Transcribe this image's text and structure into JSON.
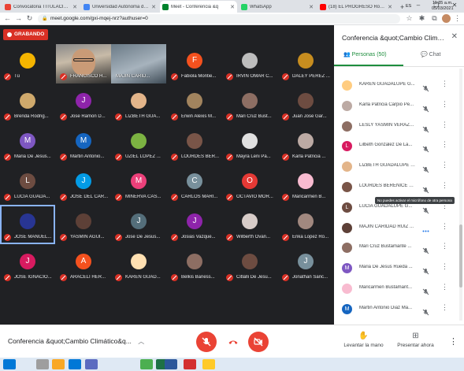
{
  "browser": {
    "tabs": [
      {
        "label": "Convocatoria TITULACIÓN I",
        "favicon_color": "#ea4335",
        "active": false
      },
      {
        "label": "Universidad Autónoma de G",
        "favicon_color": "#4285f4",
        "active": false
      },
      {
        "label": "Meet - Conferencia &q",
        "favicon_color": "#00832d",
        "active": true
      },
      {
        "label": "WhatsApp",
        "favicon_color": "#25d366",
        "active": false
      },
      {
        "label": "(18) EL PROGRESO Roberto",
        "favicon_color": "#ff0000",
        "active": false
      }
    ],
    "new_tab": "+",
    "url": "meet.google.com/gxi-mqej-nrz?authuser=0",
    "window_controls": [
      "–",
      "❐",
      "✕"
    ]
  },
  "recording_badge": "GRABANDO",
  "participants_grid": [
    {
      "name": "Tú",
      "initial": "",
      "color": "#f4b400",
      "muted": true,
      "video": false,
      "photo": true
    },
    {
      "name": "FRANCISCO H...",
      "initial": "",
      "color": "#555555",
      "muted": true,
      "video": true,
      "variant": "v1"
    },
    {
      "name": "MAJIN CARID...",
      "initial": "",
      "color": "#555555",
      "muted": false,
      "video": true,
      "variant": "v2",
      "active": true
    },
    {
      "name": "Fabiola Montie...",
      "initial": "F",
      "color": "#f4511e",
      "muted": true,
      "video": false
    },
    {
      "name": "IRVIN OMAR C...",
      "initial": "",
      "color": "#bdbdbd",
      "muted": true,
      "video": false,
      "photo": true
    },
    {
      "name": "DALEY PEREZ ...",
      "initial": "",
      "color": "#c78d1f",
      "muted": true,
      "video": false,
      "photo": true
    },
    {
      "name": "Brenda Rodrig...",
      "initial": "",
      "color": "#cfa96c",
      "muted": true,
      "video": false,
      "photo": true
    },
    {
      "name": "Jose Ramon D...",
      "initial": "J",
      "color": "#8e24aa",
      "muted": true,
      "video": false
    },
    {
      "name": "LIZBETH GUA...",
      "initial": "",
      "color": "#e3b58a",
      "muted": true,
      "video": false,
      "photo": true
    },
    {
      "name": "Erwin Alexis M...",
      "initial": "",
      "color": "#a2845e",
      "muted": true,
      "video": false,
      "photo": true
    },
    {
      "name": "Mari Cruz Bust...",
      "initial": "",
      "color": "#8d6e63",
      "muted": true,
      "video": false,
      "photo": true
    },
    {
      "name": "Juan Jose Gar...",
      "initial": "",
      "color": "#6d4c41",
      "muted": true,
      "video": false,
      "photo": true
    },
    {
      "name": "Maria De Jesus...",
      "initial": "M",
      "color": "#7e57c2",
      "muted": true,
      "video": false
    },
    {
      "name": "Martin Antonio...",
      "initial": "M",
      "color": "#1565c0",
      "muted": true,
      "video": false
    },
    {
      "name": "UZIEL LOPEZ ...",
      "initial": "",
      "color": "#7cb342",
      "muted": true,
      "video": false,
      "photo": true
    },
    {
      "name": "LOURDES BER...",
      "initial": "",
      "color": "#795548",
      "muted": true,
      "video": false,
      "photo": true
    },
    {
      "name": "Mayra Leni Pa...",
      "initial": "",
      "color": "#e0e0e0",
      "muted": true,
      "video": false,
      "photo": true
    },
    {
      "name": "Karla Patricia ...",
      "initial": "",
      "color": "#bcaaa4",
      "muted": true,
      "video": false,
      "photo": true
    },
    {
      "name": "LUCIA GUADA...",
      "initial": "L",
      "color": "#6d4c41",
      "muted": true,
      "video": false
    },
    {
      "name": "JOSE DEL CAR...",
      "initial": "J",
      "color": "#039be5",
      "muted": true,
      "video": false
    },
    {
      "name": "MINERVA CAS...",
      "initial": "M",
      "color": "#ec407a",
      "muted": true,
      "video": false
    },
    {
      "name": "CARLOS MARI...",
      "initial": "C",
      "color": "#78909c",
      "muted": true,
      "video": false
    },
    {
      "name": "OCTAVIO MOR...",
      "initial": "O",
      "color": "#e53935",
      "muted": true,
      "video": false
    },
    {
      "name": "Maricarmen B...",
      "initial": "",
      "color": "#f8bbd0",
      "muted": true,
      "video": false,
      "photo": true
    },
    {
      "name": "JOSE MANUEL...",
      "initial": "",
      "color": "#283593",
      "muted": true,
      "video": false,
      "photo": true,
      "active": true
    },
    {
      "name": "YASMIN AGUI...",
      "initial": "",
      "color": "#5d4037",
      "muted": true,
      "video": false,
      "photo": true
    },
    {
      "name": "Jose De Jesus...",
      "initial": "J",
      "color": "#546e7a",
      "muted": true,
      "video": false
    },
    {
      "name": "Josias Vazque...",
      "initial": "J",
      "color": "#8e24aa",
      "muted": true,
      "video": false
    },
    {
      "name": "Wilberth Ovan...",
      "initial": "",
      "color": "#d7ccc8",
      "muted": true,
      "video": false,
      "photo": true
    },
    {
      "name": "Erika Lopez Ro...",
      "initial": "",
      "color": "#a1887f",
      "muted": true,
      "video": false,
      "photo": true
    },
    {
      "name": "JOSE IGNACIO...",
      "initial": "J",
      "color": "#d81b60",
      "muted": true,
      "video": false
    },
    {
      "name": "ARACELI HER...",
      "initial": "A",
      "color": "#f4511e",
      "muted": true,
      "video": false
    },
    {
      "name": "KAREN GUAD...",
      "initial": "",
      "color": "#ffe0b2",
      "muted": true,
      "video": false,
      "photo": true
    },
    {
      "name": "Belkis Baness...",
      "initial": "",
      "color": "#8d6e63",
      "muted": true,
      "video": false,
      "photo": true
    },
    {
      "name": "Citlalli De Jesu...",
      "initial": "",
      "color": "#6d4c41",
      "muted": true,
      "video": false,
      "photo": true
    },
    {
      "name": "Jonathan Sanc...",
      "initial": "J",
      "color": "#78909c",
      "muted": true,
      "video": false
    }
  ],
  "bottom_bar": {
    "meeting_name": "Conferencia &quot;Cambio Climático&q...",
    "raise_hand": "Levantar la mano",
    "present": "Presentar ahora"
  },
  "side_panel": {
    "title": "Conferencia &quot;Cambio Climátic...",
    "tab_people": "Personas (50)",
    "tab_chat": "Chat",
    "rows": [
      {
        "name": "KAREN GUADALUPE G...",
        "initial": "",
        "color": "#ffcc80",
        "speaking": false
      },
      {
        "name": "Karla Patricia Carpio Pe...",
        "initial": "",
        "color": "#bcaaa4",
        "speaking": false
      },
      {
        "name": "LESLY YASMIN VERAZA...",
        "initial": "",
        "color": "#8d6e63",
        "speaking": false
      },
      {
        "name": "Lilbeth Gonzalez De La...",
        "initial": "L",
        "color": "#d81b60",
        "speaking": false
      },
      {
        "name": "LIZBETH GUADALUPE C...",
        "initial": "",
        "color": "#e3b58a",
        "speaking": false
      },
      {
        "name": "LOURDES BERENICE G...",
        "initial": "",
        "color": "#795548",
        "speaking": false
      },
      {
        "name": "LUCIA GUADALUPE G...",
        "initial": "L",
        "color": "#6d4c41",
        "speaking": false
      },
      {
        "name": "MAJIN CARIDAD RUIZ ...",
        "initial": "",
        "color": "#5d4037",
        "speaking": true
      },
      {
        "name": "Mari Cruz Bustamante ...",
        "initial": "",
        "color": "#8d6e63",
        "speaking": false
      },
      {
        "name": "Maria De Jesus Rueda ...",
        "initial": "M",
        "color": "#7e57c2",
        "speaking": false
      },
      {
        "name": "Maricarmen Bustamant...",
        "initial": "",
        "color": "#f8bbd0",
        "speaking": false
      },
      {
        "name": "Martin Antonio Diaz Ma...",
        "initial": "M",
        "color": "#1565c0",
        "speaking": false
      }
    ],
    "tooltip": "No puedes activar el micrófono de otra persona"
  },
  "taskbar": {
    "lang": "ES",
    "time": "11:35 a.m.",
    "date": "05/03/2021",
    "apps": [
      {
        "name": "start",
        "color": "#0078d7"
      },
      {
        "name": "search",
        "color": "#ffffff"
      },
      {
        "name": "task-view",
        "color": "#9e9e9e"
      },
      {
        "name": "file-explorer",
        "color": "#f9a825"
      },
      {
        "name": "edge",
        "color": "#0078d7"
      },
      {
        "name": "store",
        "color": "#5c6bc0"
      },
      {
        "name": "chrome",
        "color": "#4caf50"
      },
      {
        "name": "excel",
        "color": "#1e7145"
      },
      {
        "name": "word",
        "color": "#2b579a"
      },
      {
        "name": "acrobat",
        "color": "#d32f2f"
      },
      {
        "name": "paint",
        "color": "#ffca28"
      }
    ]
  }
}
